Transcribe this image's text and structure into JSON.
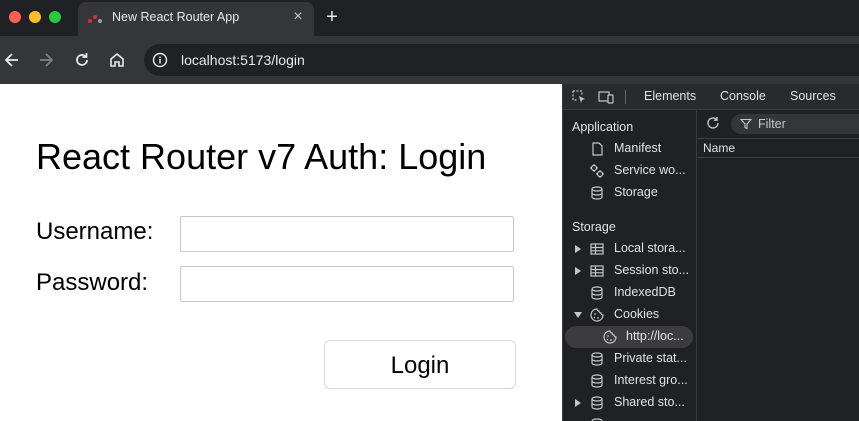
{
  "browser": {
    "tab_title": "New React Router App",
    "new_tab_symbol": "+",
    "close_symbol": "×",
    "url_host": "localhost",
    "url_path": ":5173/login"
  },
  "page": {
    "heading": "React Router v7 Auth: Login",
    "username_label": "Username:",
    "password_label": "Password:",
    "username_value": "",
    "password_value": "",
    "login_button": "Login"
  },
  "devtools": {
    "tabs": [
      "Elements",
      "Console",
      "Sources"
    ],
    "sections": {
      "application": "Application",
      "storage": "Storage"
    },
    "application_items": [
      {
        "label": "Manifest",
        "icon": "document-icon"
      },
      {
        "label": "Service wo...",
        "icon": "gears-icon"
      },
      {
        "label": "Storage",
        "icon": "database-icon"
      }
    ],
    "storage_items": [
      {
        "label": "Local stora...",
        "icon": "table-icon",
        "expandable": true
      },
      {
        "label": "Session sto...",
        "icon": "table-icon",
        "expandable": true
      },
      {
        "label": "IndexedDB",
        "icon": "database-icon",
        "expandable": false
      },
      {
        "label": "Cookies",
        "icon": "cookie-icon",
        "expanded": true
      },
      {
        "label": "http://loc...",
        "icon": "cookie-icon",
        "selected": true
      },
      {
        "label": "Private stat...",
        "icon": "database-icon",
        "expandable": false
      },
      {
        "label": "Interest gro...",
        "icon": "database-icon",
        "expandable": false
      },
      {
        "label": "Shared sto...",
        "icon": "database-icon",
        "expandable": true
      }
    ],
    "filter_placeholder": "Filter",
    "column_name": "Name"
  },
  "colors": {
    "chrome_dark": "#202124",
    "chrome_tab": "#35363a",
    "traffic_red": "#ff5f57",
    "traffic_yellow": "#febc2e",
    "traffic_green": "#28c840"
  }
}
